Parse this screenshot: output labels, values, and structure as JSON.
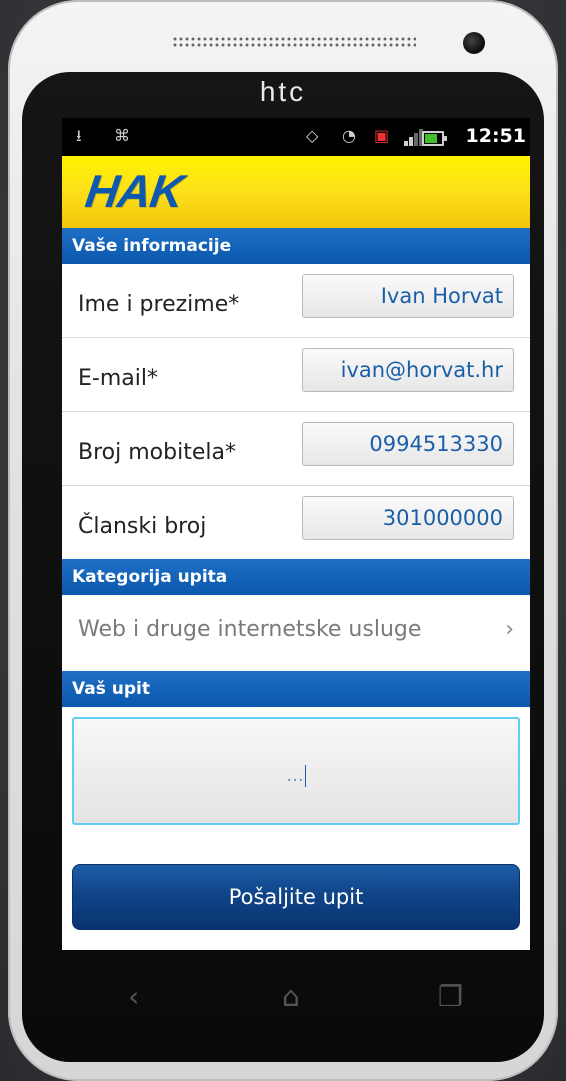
{
  "device": {
    "brand": "htc"
  },
  "statusbar": {
    "time": "12:51",
    "icons": [
      "usb-icon",
      "android-debug-icon",
      "vibrate-icon",
      "wifi-icon",
      "no-sim-icon",
      "signal-icon",
      "battery-icon"
    ]
  },
  "header": {
    "logo_text": "HAK",
    "brand_color": "#0f58b0",
    "header_color": "#fde21a"
  },
  "sections": {
    "info_title": "Vaše informacije",
    "category_title": "Kategorija upita",
    "query_title": "Vaš upit"
  },
  "form": {
    "fields": [
      {
        "label": "Ime i prezime*",
        "value": "Ivan Horvat"
      },
      {
        "label": "E-mail*",
        "value": "ivan@horvat.hr"
      },
      {
        "label": "Broj mobitela*",
        "value": "0994513330"
      },
      {
        "label": "Članski broj",
        "value": "301000000"
      }
    ]
  },
  "category": {
    "selected": "Web i druge internetske usluge",
    "chevron": "›"
  },
  "query": {
    "placeholder": "..."
  },
  "submit": {
    "label": "Pošaljite upit"
  },
  "navbar": {
    "back": "‹",
    "home": "⌂",
    "recents": "❐"
  }
}
